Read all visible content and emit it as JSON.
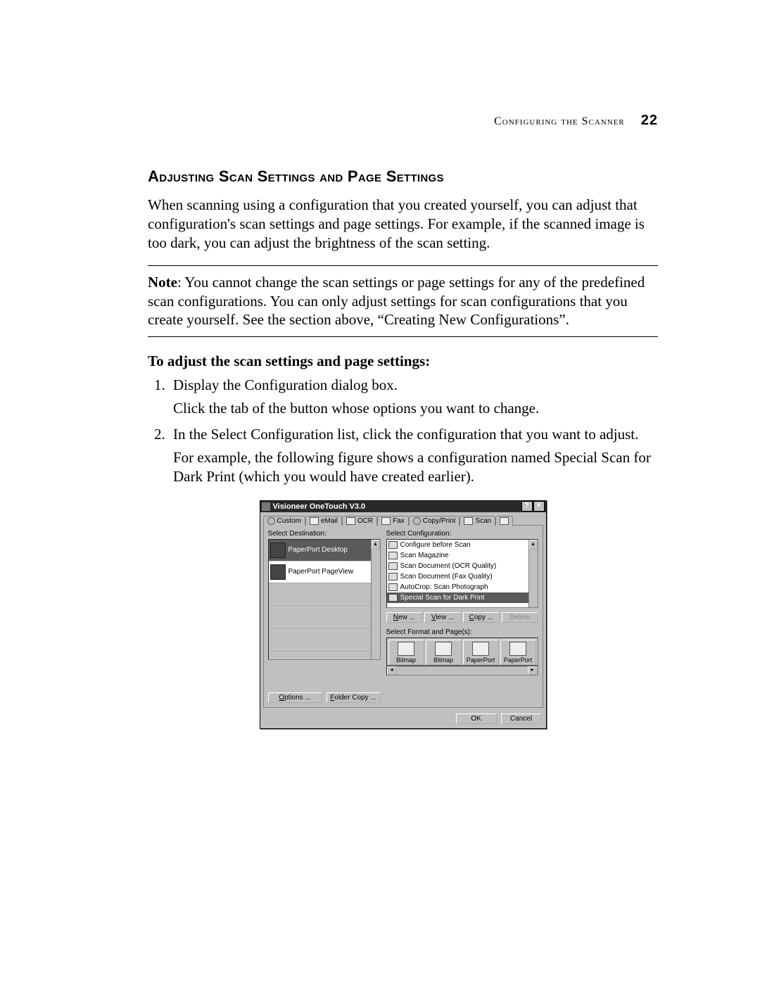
{
  "header": {
    "running": "Configuring the Scanner",
    "page_number": "22"
  },
  "section_title": "Adjusting Scan Settings and Page Settings",
  "intro": "When scanning using a configuration that you created yourself, you can adjust that configuration's scan settings and page settings. For example, if the scanned image is too dark, you can adjust the brightness of the scan setting.",
  "note_label": "Note",
  "note_body": ":  You cannot change the scan settings or page settings for any of the predefined scan configurations. You can only adjust settings for scan configurations that you create yourself. See the section above, “Creating New Configurations”.",
  "subhead": "To adjust the scan settings and page settings:",
  "steps": {
    "s1a": "Display the Configuration dialog box.",
    "s1b": "Click the tab of the button whose options you want to change.",
    "s2a": "In the Select Configuration list, click the configuration that you want to adjust.",
    "s2b": "For example, the following figure shows a configuration named Special Scan for Dark Print (which you would have created earlier)."
  },
  "dialog": {
    "title": "Visioneer OneTouch V3.0",
    "help_btn": "?",
    "close_btn": "×",
    "tabs": {
      "custom": "Custom",
      "email": "eMail",
      "ocr": "OCR",
      "fax": "Fax",
      "copyprint": "Copy/Print",
      "scan": "Scan"
    },
    "labels": {
      "select_dest": "Select Destination:",
      "select_cfg": "Select Configuration:",
      "select_fmt": "Select Format and Page(s):"
    },
    "destinations": [
      "PaperPort Desktop",
      "PaperPort PageView"
    ],
    "configurations": [
      "Configure before Scan",
      "Scan Magazine",
      "Scan Document (OCR Quality)",
      "Scan Document (Fax Quality)",
      "AutoCrop: Scan Photograph",
      "Special Scan for Dark Print"
    ],
    "cfg_buttons": {
      "new": "New ...",
      "view": "View ...",
      "copy": "Copy ...",
      "delete": "Delete"
    },
    "formats": [
      "Bitmap",
      "Bitmap",
      "PaperPort",
      "PaperPort"
    ],
    "left_buttons": {
      "options": "Options ...",
      "folder": "Folder Copy ..."
    },
    "footer": {
      "ok": "OK",
      "cancel": "Cancel"
    }
  }
}
